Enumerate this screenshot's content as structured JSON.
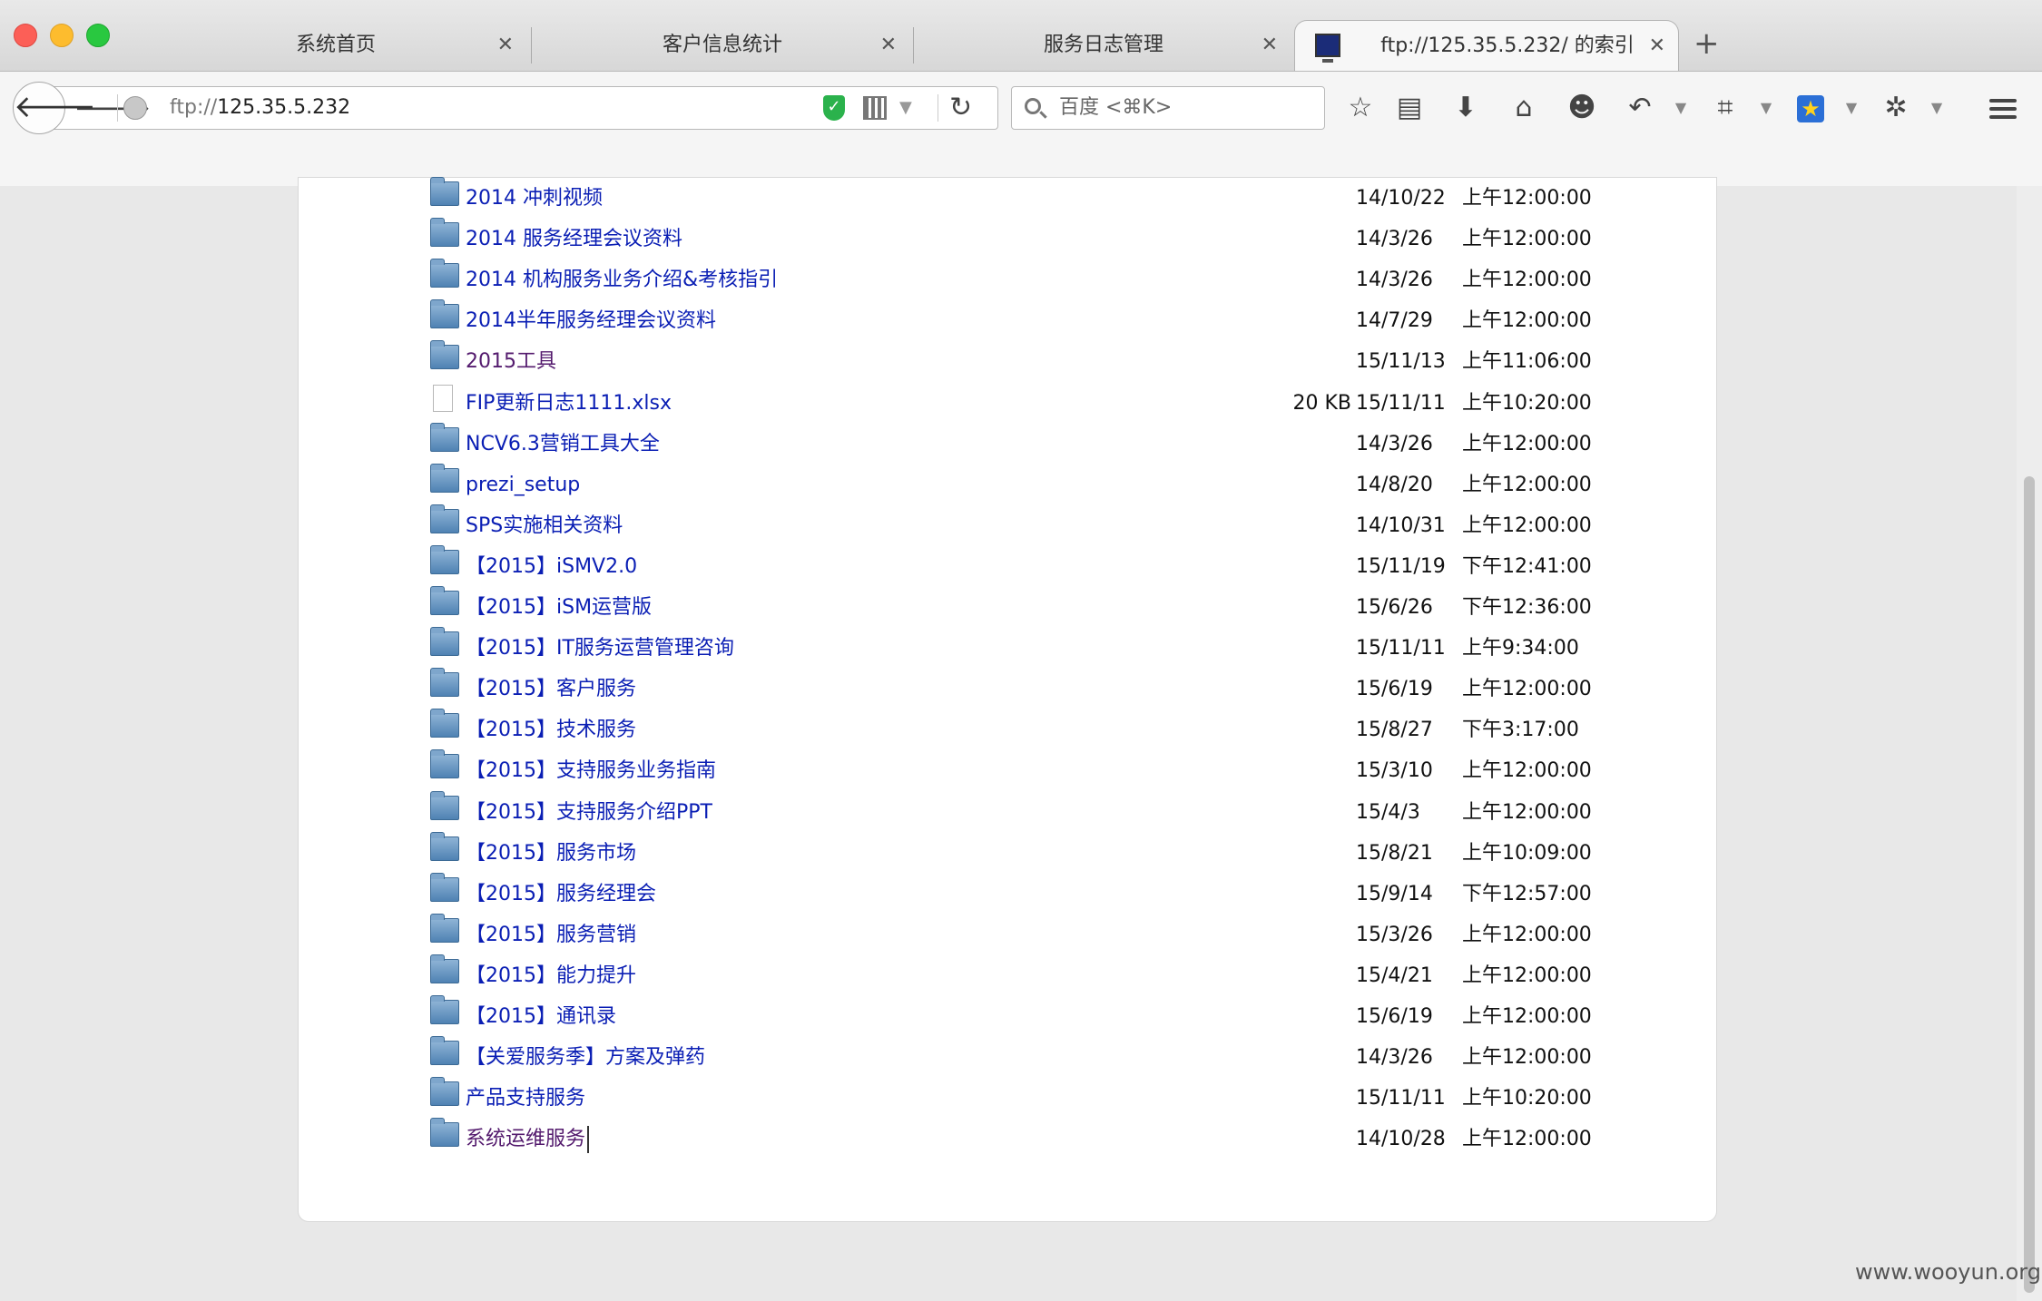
{
  "tabs": [
    {
      "label": "系统首页",
      "active": false
    },
    {
      "label": "客户信息统计",
      "active": false
    },
    {
      "label": "服务日志管理",
      "active": false
    },
    {
      "label": "ftp://125.35.5.232/ 的索引",
      "active": true
    }
  ],
  "tab_close_glyph": "✕",
  "new_tab_glyph": "+",
  "url": {
    "scheme": "ftp://",
    "host": "125.35.5.232"
  },
  "search": {
    "placeholder": "百度 <⌘K>"
  },
  "listing": [
    {
      "type": "folder",
      "name": "2014 冲刺视频",
      "size": "",
      "date": "14/10/22",
      "time": "上午12:00:00",
      "visited": false
    },
    {
      "type": "folder",
      "name": "2014 服务经理会议资料",
      "size": "",
      "date": "14/3/26",
      "time": "上午12:00:00",
      "visited": false
    },
    {
      "type": "folder",
      "name": "2014 机构服务业务介绍&考核指引",
      "size": "",
      "date": "14/3/26",
      "time": "上午12:00:00",
      "visited": false
    },
    {
      "type": "folder",
      "name": "2014半年服务经理会议资料",
      "size": "",
      "date": "14/7/29",
      "time": "上午12:00:00",
      "visited": false
    },
    {
      "type": "folder",
      "name": "2015工具",
      "size": "",
      "date": "15/11/13",
      "time": "上午11:06:00",
      "visited": true
    },
    {
      "type": "file",
      "name": "FIP更新日志1111.xlsx",
      "size": "20 KB",
      "date": "15/11/11",
      "time": "上午10:20:00",
      "visited": false
    },
    {
      "type": "folder",
      "name": "NCV6.3营销工具大全",
      "size": "",
      "date": "14/3/26",
      "time": "上午12:00:00",
      "visited": false
    },
    {
      "type": "folder",
      "name": "prezi_setup",
      "size": "",
      "date": "14/8/20",
      "time": "上午12:00:00",
      "visited": false
    },
    {
      "type": "folder",
      "name": "SPS实施相关资料",
      "size": "",
      "date": "14/10/31",
      "time": "上午12:00:00",
      "visited": false
    },
    {
      "type": "folder",
      "name": "【2015】iSMV2.0",
      "size": "",
      "date": "15/11/19",
      "time": "下午12:41:00",
      "visited": false
    },
    {
      "type": "folder",
      "name": "【2015】iSM运营版",
      "size": "",
      "date": "15/6/26",
      "time": "下午12:36:00",
      "visited": false
    },
    {
      "type": "folder",
      "name": "【2015】IT服务运营管理咨询",
      "size": "",
      "date": "15/11/11",
      "time": "上午9:34:00",
      "visited": false
    },
    {
      "type": "folder",
      "name": "【2015】客户服务",
      "size": "",
      "date": "15/6/19",
      "time": "上午12:00:00",
      "visited": false
    },
    {
      "type": "folder",
      "name": "【2015】技术服务",
      "size": "",
      "date": "15/8/27",
      "time": "下午3:17:00",
      "visited": false
    },
    {
      "type": "folder",
      "name": "【2015】支持服务业务指南",
      "size": "",
      "date": "15/3/10",
      "time": "上午12:00:00",
      "visited": false
    },
    {
      "type": "folder",
      "name": "【2015】支持服务介绍PPT",
      "size": "",
      "date": "15/4/3",
      "time": "上午12:00:00",
      "visited": false
    },
    {
      "type": "folder",
      "name": "【2015】服务市场",
      "size": "",
      "date": "15/8/21",
      "time": "上午10:09:00",
      "visited": false
    },
    {
      "type": "folder",
      "name": "【2015】服务经理会",
      "size": "",
      "date": "15/9/14",
      "time": "下午12:57:00",
      "visited": false
    },
    {
      "type": "folder",
      "name": "【2015】服务营销",
      "size": "",
      "date": "15/3/26",
      "time": "上午12:00:00",
      "visited": false
    },
    {
      "type": "folder",
      "name": "【2015】能力提升",
      "size": "",
      "date": "15/4/21",
      "time": "上午12:00:00",
      "visited": false
    },
    {
      "type": "folder",
      "name": "【2015】通讯录",
      "size": "",
      "date": "15/6/19",
      "time": "上午12:00:00",
      "visited": false
    },
    {
      "type": "folder",
      "name": "【关爱服务季】方案及弹药",
      "size": "",
      "date": "14/3/26",
      "time": "上午12:00:00",
      "visited": false
    },
    {
      "type": "folder",
      "name": "产品支持服务",
      "size": "",
      "date": "15/11/11",
      "time": "上午10:20:00",
      "visited": false
    },
    {
      "type": "folder",
      "name": "系统运维服务",
      "size": "",
      "date": "14/10/28",
      "time": "上午12:00:00",
      "visited": true
    }
  ],
  "watermark": "www.wooyun.org",
  "icons": [
    "back-arrow-icon",
    "forward-arrow-icon",
    "globe-icon",
    "shield-icon",
    "qr-code-icon",
    "reload-icon",
    "search-icon",
    "bookmark-star-icon",
    "reading-list-icon",
    "download-icon",
    "home-icon",
    "chat-icon",
    "undo-icon",
    "crop-icon",
    "favorites-icon",
    "addon-icon",
    "menu-icon",
    "folder-icon",
    "file-icon"
  ],
  "colors": {
    "link": "#0a1eb4",
    "visited_link": "#541b6e",
    "shield": "#2bb24c"
  }
}
